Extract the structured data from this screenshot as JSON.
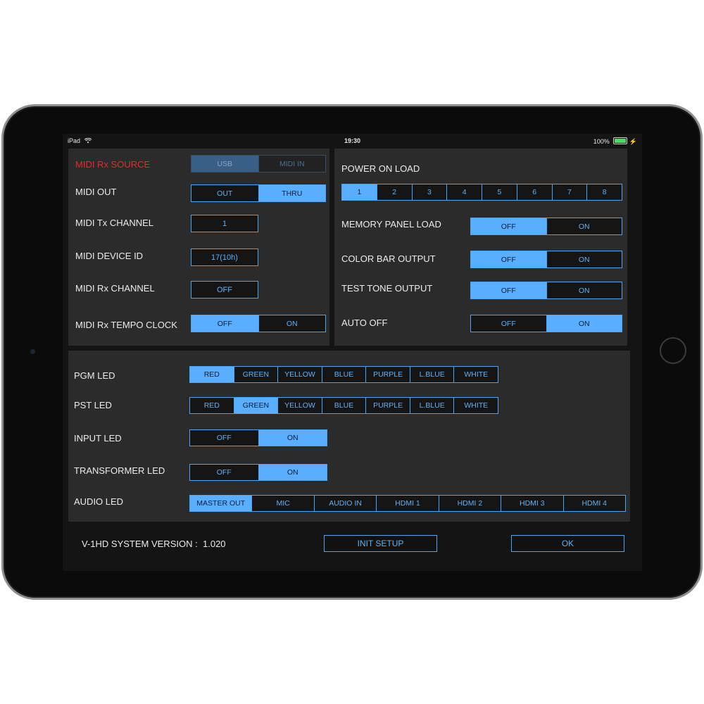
{
  "status": {
    "device": "iPad",
    "time": "19:30",
    "battery": "100%"
  },
  "left_panel": {
    "midi_rx_source": {
      "label": "MIDI Rx SOURCE",
      "options": [
        "USB",
        "MIDI IN"
      ],
      "selected": "USB"
    },
    "midi_out": {
      "label": "MIDI OUT",
      "options": [
        "OUT",
        "THRU"
      ],
      "selected": "THRU"
    },
    "midi_tx_channel": {
      "label": "MIDI Tx CHANNEL",
      "value": "1"
    },
    "midi_device_id": {
      "label": "MIDI DEVICE ID",
      "value": "17(10h)"
    },
    "midi_rx_channel": {
      "label": "MIDI Rx CHANNEL",
      "value": "OFF"
    },
    "midi_rx_tempo_clock": {
      "label": "MIDI Rx TEMPO CLOCK",
      "options": [
        "OFF",
        "ON"
      ],
      "selected": "OFF"
    }
  },
  "right_panel": {
    "power_on_load": {
      "label": "POWER ON LOAD",
      "options": [
        "1",
        "2",
        "3",
        "4",
        "5",
        "6",
        "7",
        "8"
      ],
      "selected": "1"
    },
    "memory_panel_load": {
      "label": "MEMORY PANEL LOAD",
      "options": [
        "OFF",
        "ON"
      ],
      "selected": "OFF"
    },
    "color_bar_output": {
      "label": "COLOR BAR OUTPUT",
      "options": [
        "OFF",
        "ON"
      ],
      "selected": "OFF"
    },
    "test_tone_output": {
      "label": "TEST TONE OUTPUT",
      "options": [
        "OFF",
        "ON"
      ],
      "selected": "OFF"
    },
    "auto_off": {
      "label": "AUTO OFF",
      "options": [
        "OFF",
        "ON"
      ],
      "selected": "ON"
    }
  },
  "bottom_panel": {
    "pgm_led": {
      "label": "PGM LED",
      "options": [
        "RED",
        "GREEN",
        "YELLOW",
        "BLUE",
        "PURPLE",
        "L.BLUE",
        "WHITE"
      ],
      "selected": "RED"
    },
    "pst_led": {
      "label": "PST LED",
      "options": [
        "RED",
        "GREEN",
        "YELLOW",
        "BLUE",
        "PURPLE",
        "L.BLUE",
        "WHITE"
      ],
      "selected": "GREEN"
    },
    "input_led": {
      "label": "INPUT LED",
      "options": [
        "OFF",
        "ON"
      ],
      "selected": "ON"
    },
    "transformer_led": {
      "label": "TRANSFORMER LED",
      "options": [
        "OFF",
        "ON"
      ],
      "selected": "ON"
    },
    "audio_led": {
      "label": "AUDIO LED",
      "options": [
        "MASTER OUT",
        "MIC",
        "AUDIO IN",
        "HDMI 1",
        "HDMI 2",
        "HDMI 3",
        "HDMI 4"
      ],
      "selected": "MASTER OUT"
    }
  },
  "footer": {
    "version_label": "V-1HD SYSTEM VERSION :",
    "version_value": "1.020",
    "init_setup": "INIT SETUP",
    "ok": "OK"
  },
  "colors": {
    "accent": "#5aaeff",
    "source_label": "#e52b2b",
    "panel": "#2b2b2b"
  }
}
